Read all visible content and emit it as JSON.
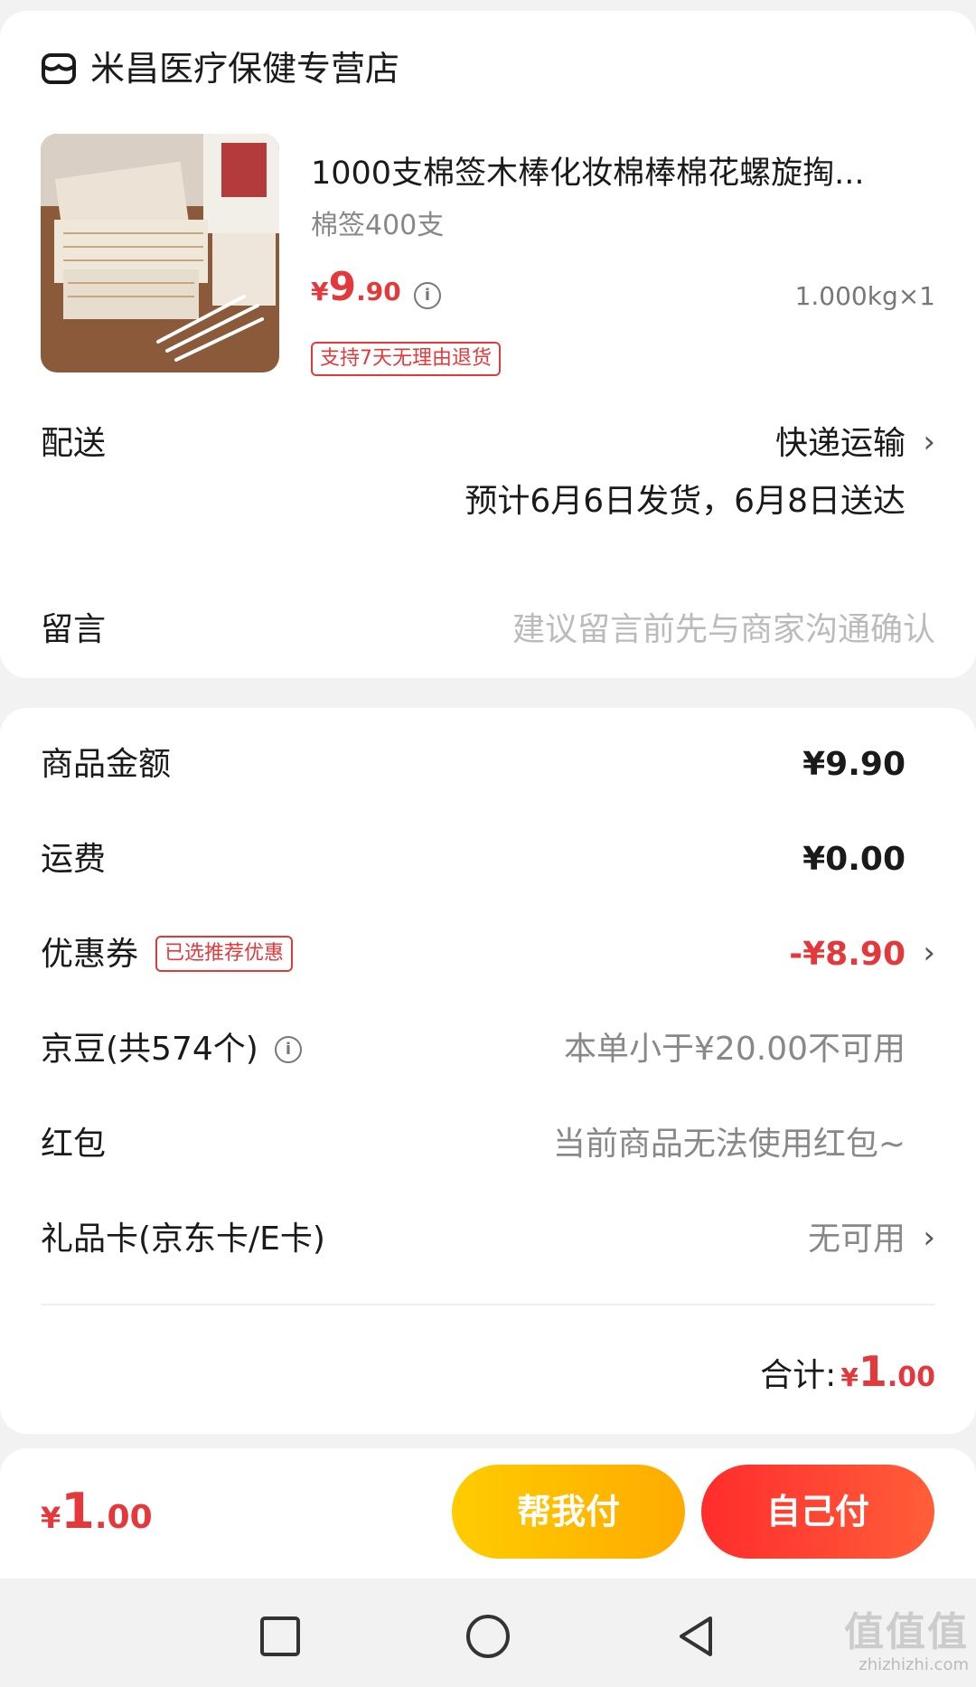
{
  "store": {
    "icon": "store-icon",
    "name": "米昌医疗保健专营店"
  },
  "product": {
    "title": "1000支棉签木棒化妆棉棒棉花螺旋掏...",
    "spec": "棉签400支",
    "price_symbol": "¥",
    "price_int": "9",
    "price_dec": ".90",
    "info_icon": "i",
    "weight": "1.000kg×1",
    "return_tag": "支持7天无理由退货"
  },
  "delivery": {
    "label": "配送",
    "method": "快递运输",
    "estimate": "预计6月6日发货，6月8日送达"
  },
  "message": {
    "label": "留言",
    "placeholder": "建议留言前先与商家沟通确认"
  },
  "summary": {
    "goods_label": "商品金额",
    "goods_value": "¥9.90",
    "shipping_label": "运费",
    "shipping_value": "¥0.00",
    "coupon_label": "优惠券",
    "coupon_tag": "已选推荐优惠",
    "coupon_value": "-¥8.90",
    "jd_beans_label": "京豆(共574个)",
    "jd_beans_value": "本单小于¥20.00不可用",
    "red_packet_label": "红包",
    "red_packet_value": "当前商品无法使用红包~",
    "gift_card_label": "礼品卡(京东卡/E卡)",
    "gift_card_value": "无可用",
    "total_label": "合计:",
    "total_symbol": "¥",
    "total_int": "1",
    "total_dec": ".00"
  },
  "bottom": {
    "pay_symbol": "¥",
    "pay_int": "1",
    "pay_dec": ".00",
    "help_pay_label": "帮我付",
    "self_pay_label": "自己付"
  },
  "watermark": {
    "big": "值值值",
    "small": "zhizhizhi.com"
  },
  "colors": {
    "accent_red": "#e4393c",
    "help_button": "#ffbb00",
    "self_button": "#ff3b30"
  },
  "chevron": "›"
}
